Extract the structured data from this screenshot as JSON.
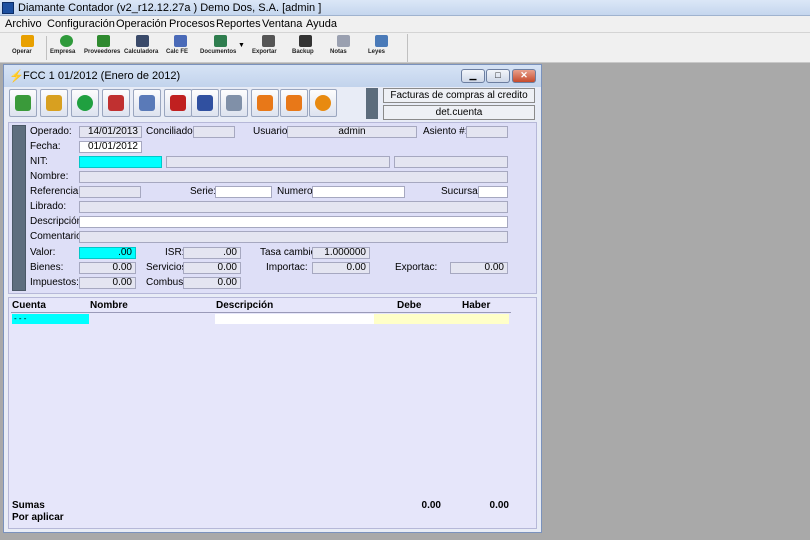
{
  "app": {
    "title": "Diamante Contador (v2_r12.12.27a ) Demo Dos, S.A.  [admin ]"
  },
  "menu": [
    "Archivo",
    "Configuración",
    "Operación",
    "Procesos",
    "Reportes",
    "Ventana",
    "Ayuda"
  ],
  "toolbar": [
    {
      "label": "Operar",
      "icon": "bolt-icon",
      "color": "#e8a000"
    },
    {
      "label": "Empresa",
      "icon": "refresh-icon",
      "color": "#2f9a3b"
    },
    {
      "label": "Proveedores",
      "icon": "person-icon",
      "color": "#2f8a2f"
    },
    {
      "label": "Calculadora",
      "icon": "calculator-icon",
      "color": "#3a4a6a"
    },
    {
      "label": "Calc FE",
      "icon": "formula-icon",
      "color": "#4a6ab8"
    },
    {
      "label": "Documentos",
      "icon": "documents-icon",
      "color": "#2e7d4e"
    },
    {
      "label": "Exportar",
      "icon": "export-icon",
      "color": "#555555"
    },
    {
      "label": "Backup",
      "icon": "disk-icon",
      "color": "#333333"
    },
    {
      "label": "Notas",
      "icon": "notes-icon",
      "color": "#9aa0b0"
    },
    {
      "label": "Leyes",
      "icon": "scale-icon",
      "color": "#4a7ab8"
    }
  ],
  "child_window": {
    "title": "FCC 1 01/2012 (Enero de 2012)",
    "buttons": [
      {
        "icon": "download-icon",
        "color": "#3a9a3a"
      },
      {
        "icon": "upload-icon",
        "color": "#d8a020"
      },
      {
        "icon": "new-document-icon",
        "color": "#20a040"
      },
      {
        "icon": "edit-icon",
        "color": "#c03030"
      },
      {
        "icon": "trash-icon",
        "color": "#5a7ab8"
      },
      {
        "icon": "delete-document-icon",
        "color": "#c02020"
      },
      {
        "icon": "grid-delete-icon",
        "color": "#3050a0"
      },
      {
        "icon": "attach-icon",
        "color": "#8090a8"
      },
      {
        "icon": "printer-icon",
        "color": "#e87818"
      },
      {
        "icon": "printer-2-icon",
        "color": "#e87818"
      },
      {
        "icon": "help-icon",
        "color": "#e88a10"
      }
    ],
    "info_top": "Facturas de compras al credito",
    "info_bottom": "det.cuenta"
  },
  "form": {
    "operado_label": "Operado:",
    "operado_value": "14/01/2013",
    "conciliado_label": "Conciliado:",
    "conciliado_value": "",
    "usuario_label": "Usuario:",
    "usuario_value": "admin",
    "asiento_label": "Asiento #:",
    "asiento_value": "",
    "fecha_label": "Fecha:",
    "fecha_value": "01/01/2012",
    "nit_label": "NIT:",
    "nombre_label": "Nombre:",
    "referencia_label": "Referencia:",
    "serie_label": "Serie:",
    "numero_label": "Numero:",
    "sucursal_label": "Sucursal:",
    "librado_label": "Librado:",
    "descripcion_label": "Descripción:",
    "comentario_label": "Comentario:",
    "valor_label": "Valor:",
    "valor_value": ".00",
    "isr_label": "ISR:",
    "isr_value": ".00",
    "tasa_label": "Tasa cambio:",
    "tasa_value": "1.000000",
    "bienes_label": "Bienes:",
    "bienes_value": "0.00",
    "servicios_label": "Servicios:",
    "servicios_value": "0.00",
    "importac_label": "Importac:",
    "importac_value": "0.00",
    "exportac_label": "Exportac:",
    "exportac_value": "0.00",
    "impuestos_label": "Impuestos:",
    "impuestos_value": "0.00",
    "combust_label": "Combust:",
    "combust_value": "0.00"
  },
  "grid": {
    "columns": [
      "Cuenta",
      "Nombre",
      "Descripción",
      "Debe",
      "Haber"
    ],
    "first_row_cuenta": "- - -",
    "sumas_label": "Sumas",
    "por_aplicar_label": "Por aplicar",
    "sum_debe": "0.00",
    "sum_haber": "0.00"
  }
}
